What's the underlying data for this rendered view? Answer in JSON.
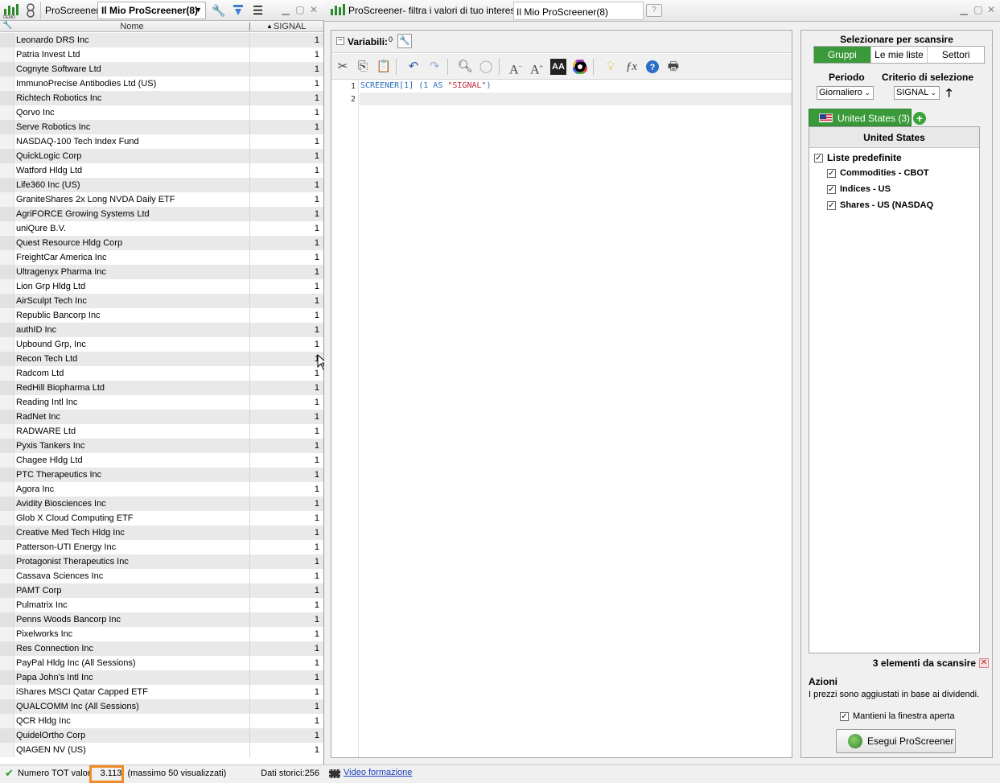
{
  "left_panel": {
    "app_label": "ProScreener",
    "tab_label": "Il Mio ProScreener(8)",
    "columns": {
      "name": "Nome",
      "signal": "SIGNAL"
    },
    "rows": [
      {
        "name": "Leonardo DRS Inc",
        "value": "1"
      },
      {
        "name": "Patria Invest Ltd",
        "value": "1"
      },
      {
        "name": "Cognyte Software Ltd",
        "value": "1"
      },
      {
        "name": "ImmunoPrecise Antibodies Ltd (US)",
        "value": "1"
      },
      {
        "name": "Richtech Robotics Inc",
        "value": "1"
      },
      {
        "name": "Qorvo Inc",
        "value": "1"
      },
      {
        "name": "Serve Robotics Inc",
        "value": "1"
      },
      {
        "name": "NASDAQ-100 Tech Index Fund",
        "value": "1"
      },
      {
        "name": "QuickLogic Corp",
        "value": "1"
      },
      {
        "name": "Watford Hldg Ltd",
        "value": "1"
      },
      {
        "name": "Life360 Inc (US)",
        "value": "1"
      },
      {
        "name": "GraniteShares 2x Long NVDA Daily ETF",
        "value": "1"
      },
      {
        "name": "AgriFORCE Growing Systems Ltd",
        "value": "1"
      },
      {
        "name": "uniQure B.V.",
        "value": "1"
      },
      {
        "name": "Quest Resource Hldg Corp",
        "value": "1"
      },
      {
        "name": "FreightCar America Inc",
        "value": "1"
      },
      {
        "name": "Ultragenyx Pharma Inc",
        "value": "1"
      },
      {
        "name": "Lion Grp Hldg Ltd",
        "value": "1"
      },
      {
        "name": "AirSculpt Tech Inc",
        "value": "1"
      },
      {
        "name": "Republic Bancorp Inc",
        "value": "1"
      },
      {
        "name": "authID Inc",
        "value": "1"
      },
      {
        "name": "Upbound Grp, Inc",
        "value": "1"
      },
      {
        "name": "Recon Tech Ltd",
        "value": "1"
      },
      {
        "name": "Radcom Ltd",
        "value": "1"
      },
      {
        "name": "RedHill Biopharma Ltd",
        "value": "1"
      },
      {
        "name": "Reading Intl Inc",
        "value": "1"
      },
      {
        "name": "RadNet Inc",
        "value": "1"
      },
      {
        "name": "RADWARE Ltd",
        "value": "1"
      },
      {
        "name": "Pyxis Tankers Inc",
        "value": "1"
      },
      {
        "name": "Chagee Hldg Ltd",
        "value": "1"
      },
      {
        "name": "PTC Therapeutics Inc",
        "value": "1"
      },
      {
        "name": "Agora Inc",
        "value": "1"
      },
      {
        "name": "Avidity Biosciences Inc",
        "value": "1"
      },
      {
        "name": "Glob X Cloud Computing ETF",
        "value": "1"
      },
      {
        "name": "Creative Med Tech Hldg Inc",
        "value": "1"
      },
      {
        "name": "Patterson-UTI Energy Inc",
        "value": "1"
      },
      {
        "name": "Protagonist Therapeutics Inc",
        "value": "1"
      },
      {
        "name": "Cassava Sciences Inc",
        "value": "1"
      },
      {
        "name": "PAMT Corp",
        "value": "1"
      },
      {
        "name": "Pulmatrix Inc",
        "value": "1"
      },
      {
        "name": "Penns Woods Bancorp Inc",
        "value": "1"
      },
      {
        "name": "Pixelworks Inc",
        "value": "1"
      },
      {
        "name": "Res Connection Inc",
        "value": "1"
      },
      {
        "name": "PayPal Hldg Inc (All Sessions)",
        "value": "1"
      },
      {
        "name": "Papa John's Intl Inc",
        "value": "1"
      },
      {
        "name": "iShares MSCI Qatar Capped ETF",
        "value": "1"
      },
      {
        "name": "QUALCOMM Inc (All Sessions)",
        "value": "1"
      },
      {
        "name": "QCR Hldg Inc",
        "value": "1"
      },
      {
        "name": "QuidelOrtho Corp",
        "value": "1"
      },
      {
        "name": "QIAGEN NV (US)",
        "value": "1"
      }
    ],
    "status": {
      "prefix": "Numero TOT valor",
      "count": "3.113",
      "suffix": "(massimo 50 visualizzati)",
      "history": "Dati storici:256"
    }
  },
  "right_window": {
    "title": "ProScreener- filtra i valori di tuo interesse",
    "tab_label": "Il Mio ProScreener(8)",
    "variables_label": "Variabili:",
    "variables_count": "0",
    "code": {
      "line_numbers": [
        "1",
        "2"
      ],
      "line1": {
        "fn": "SCREENER[1] (1 AS ",
        "str": "\"SIGNAL\"",
        "end": ")"
      }
    },
    "side": {
      "heading": "Selezionare per scansire",
      "segments": [
        "Gruppi",
        "Le mie liste",
        "Settori"
      ],
      "periodo_label": "Periodo",
      "criterio_label": "Criterio di selezione",
      "periodo_value": "Giornaliero",
      "criterio_value": "SIGNAL",
      "arrow": "🡑",
      "market_tab": "United States (3)",
      "tree_header": "United States",
      "tree_items": [
        "Liste predefinite",
        "Commodities - CBOT",
        "Indices - US",
        "Shares - US (NASDAQ"
      ],
      "count_text": "3 elementi da scansire",
      "actions_title": "Azioni",
      "actions_text": "I prezzi sono aggiustati in base ai dividendi.",
      "keep_open": "Mantieni la finestra aperta",
      "run_button": "Esegui ProScreener"
    },
    "status_link": "Video formazione"
  },
  "colors": {
    "accent_green": "#3a9a3a",
    "highlight_orange": "#f08a24",
    "link_blue": "#1a3fbf"
  }
}
